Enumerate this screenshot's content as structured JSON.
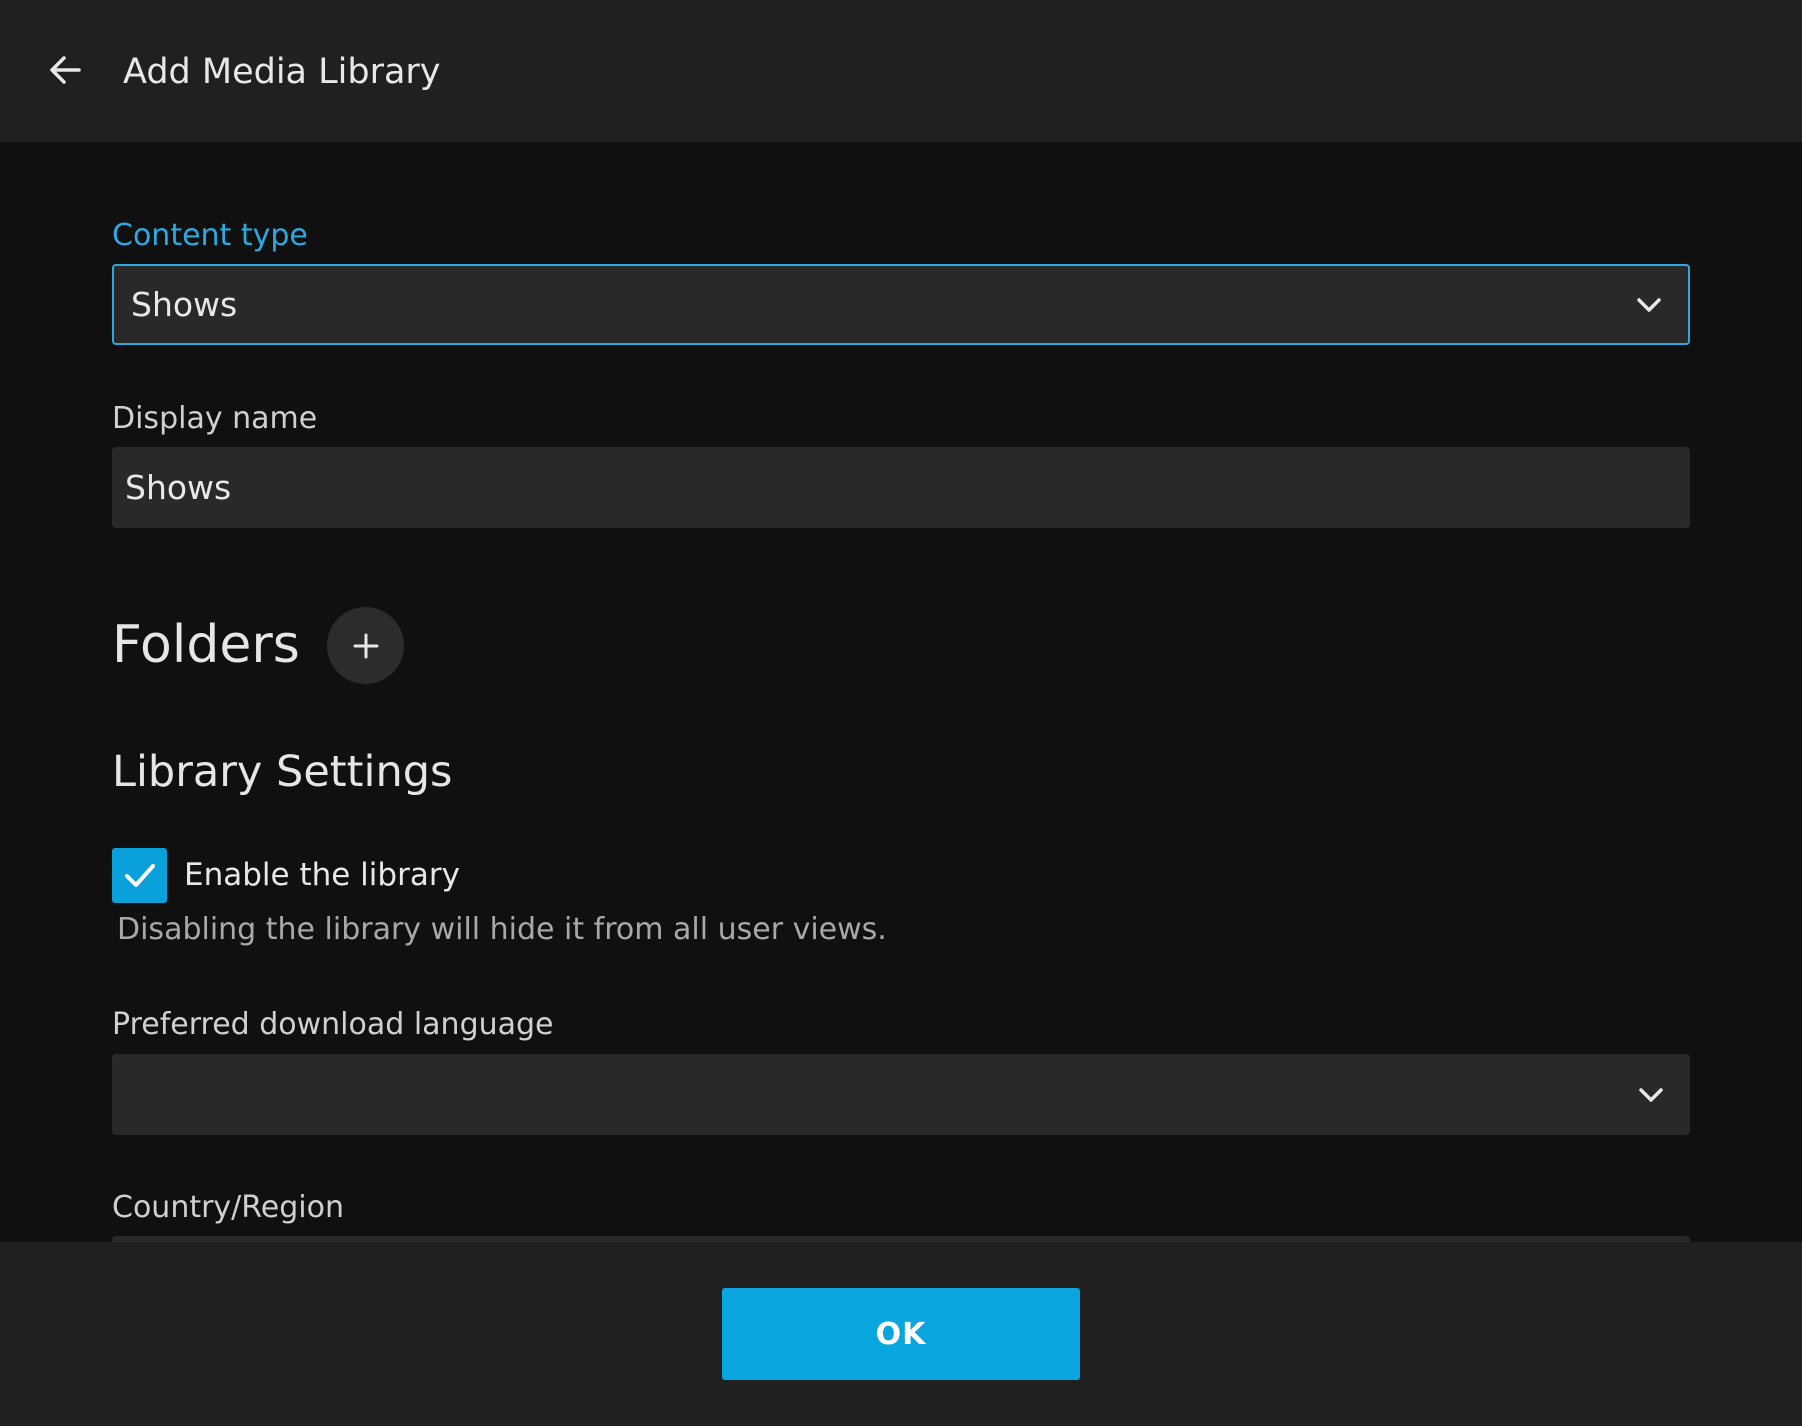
{
  "header": {
    "title": "Add Media Library",
    "back_icon": "arrow-left-icon"
  },
  "content_type": {
    "label": "Content type",
    "value": "Shows"
  },
  "display_name": {
    "label": "Display name",
    "value": "Shows"
  },
  "folders": {
    "title": "Folders",
    "add_icon": "plus-icon"
  },
  "library_settings": {
    "title": "Library Settings",
    "enable_library": {
      "label": "Enable the library",
      "checked": true,
      "help": "Disabling the library will hide it from all user views."
    },
    "preferred_language": {
      "label": "Preferred download language",
      "value": ""
    },
    "country_region": {
      "label": "Country/Region",
      "value": ""
    }
  },
  "footer": {
    "ok_label": "OK"
  },
  "colors": {
    "accent": "#0aa6e0",
    "label_active": "#2ea8e0",
    "header_bg": "#202020",
    "page_bg": "#101010",
    "field_bg": "#292929"
  }
}
